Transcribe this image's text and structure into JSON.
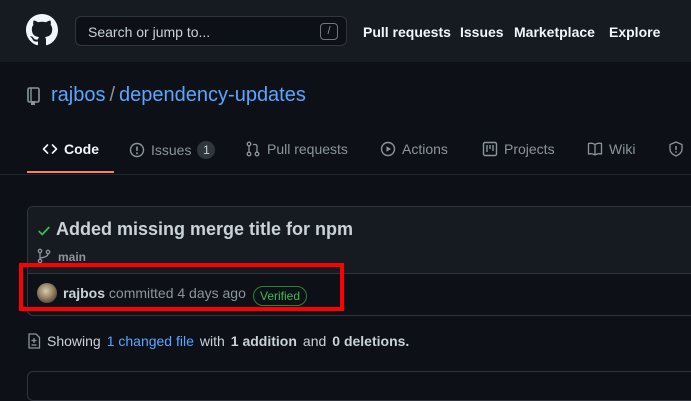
{
  "header": {
    "search_placeholder": "Search or jump to...",
    "slash_key": "/",
    "nav": [
      "Pull requests",
      "Issues",
      "Marketplace",
      "Explore"
    ]
  },
  "repo": {
    "owner": "rajbos",
    "separator": "/",
    "name": "dependency-updates"
  },
  "tabs": {
    "code": "Code",
    "issues": "Issues",
    "issues_count": "1",
    "pull_requests": "Pull requests",
    "actions": "Actions",
    "projects": "Projects",
    "wiki": "Wiki"
  },
  "commit": {
    "title": "Added missing merge title for npm",
    "branch": "main",
    "author": "rajbos",
    "action_text": "committed 4 days ago",
    "badge": "Verified"
  },
  "summary": {
    "prefix": "Showing",
    "changed_link": "1 changed file",
    "with": "with",
    "additions": "1 addition",
    "and": "and",
    "deletions": "0 deletions."
  },
  "colors": {
    "accent": "#58a6ff",
    "tab_underline": "#f78166",
    "verified": "#3fb950",
    "highlight": "#ff0000"
  }
}
